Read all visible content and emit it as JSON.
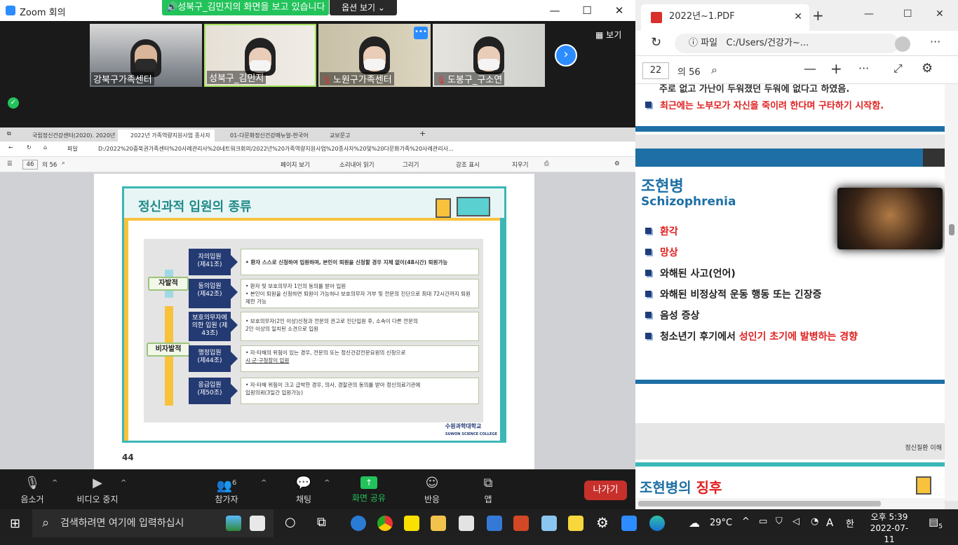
{
  "zoom": {
    "title": "Zoom 회의",
    "share_banner": "성북구_김민지의 화면을 보고 있습니다",
    "share_options": "옵션 보기 ⌄",
    "view_label": "보기",
    "participants": [
      {
        "name": "강북구가족센터",
        "muted": false
      },
      {
        "name": "성북구_김민지",
        "muted": false
      },
      {
        "name": "노원구가족센터",
        "muted": true
      },
      {
        "name": "도봉구_구소연",
        "muted": true
      }
    ],
    "toolbar": {
      "mute": "음소거",
      "video": "비디오 중지",
      "participants": "참가자",
      "participants_count": "6",
      "chat": "채팅",
      "share": "화면 공유",
      "reaction": "반응",
      "apps": "앱",
      "leave": "나가기"
    }
  },
  "shared": {
    "tabs": [
      "국립정신건강센터(2020). 2020년",
      "2022년 가족역량지원사업 종사자",
      "01-다문화정신건강매뉴얼-한국어",
      "교보문고"
    ],
    "address_label": "파일",
    "address": "D:/2022%20중북권가족센터%20사례관리사%20네트워크회의/2022년%20가족역량지원사업%20종사자%20및%20다문화가족%20사례관리사...",
    "page": "46",
    "page_total": "의 56",
    "tools": [
      "페이지 보기",
      "소리내어 읽기",
      "그리기",
      "강조 표시",
      "지우기"
    ],
    "slide": {
      "title": "정신과적 입원의 종류",
      "voluntary": "자발적",
      "involuntary": "비자발적",
      "rows": [
        {
          "tag1": "자의입원",
          "tag2": "(제41조)",
          "desc1": "• 환자 스스로 신청하여 입원하며, 본인이 퇴원을 신청할 경우 지체 없이(48시간) 퇴원가능",
          "desc2": ""
        },
        {
          "tag1": "동의입원",
          "tag2": "(제42조)",
          "desc1": "• 환자 및 보호의무자 1인의 동의를 받아 입원",
          "desc2": "• 본인이 퇴원을 신청하면 퇴원이 가능하나 보호의무자 거부 및 전문의 진단으로 최대 72시간까지 퇴원제한 가능"
        },
        {
          "tag1": "보호의무자에",
          "tag2": "의한 입원 (제43조)",
          "desc1": "• 보호의무자(2인 이상)신청과 전문의 권고로 진단입원 후, 소속이 다른 전문의",
          "desc2": "2인 이상의 일치된 소견으로 입원"
        },
        {
          "tag1": "행정입원",
          "tag2": "(제44조)",
          "desc1": "• 자·타해의 위험이 있는 경우, 전문의 또는 정신건강전문요원의 신청으로",
          "desc2": "시·군·구청장이 입원"
        },
        {
          "tag1": "응급입원",
          "tag2": "(제50조)",
          "desc1": "• 자·타해 위험이 크고 급박한 경우, 의사, 경찰관의 동의를 받아 정신의료기관에",
          "desc2": "입원의뢰(3일간 입원가능)"
        }
      ],
      "footer": "수원과학대학교",
      "footer_sub": "SUWON SCIENCE COLLEGE"
    },
    "page_number": "44"
  },
  "pdf": {
    "tab_title": "2022년~1.PDF",
    "address_label": "파일",
    "address": "C:/Users/건강가~...",
    "page": "22",
    "page_total": "의 56",
    "page1_partial": "주로 없고 가난이 두워졌던 두워에 없다고 하였음.",
    "page1_bullet": "최근에는 노부모가 자신을 죽이려 한다며 구타하기 시작함.",
    "page2_title_ko": "조현병",
    "page2_title_en": "Schizophrenia",
    "page2_bullets": [
      "환각",
      "망상",
      "와해된 사고(언어)",
      "와해된 비정상적 운동 행동 또는 긴장증",
      "음성 증상"
    ],
    "page2_last_prefix": "청소년기 후기에서 ",
    "page2_last_red": "성인기 초기에 발병하는 경향",
    "page2_footer": "정신질환 이해",
    "page3_title_a": "조현병의 ",
    "page3_title_b": "징후"
  },
  "taskbar": {
    "search_placeholder": "검색하려면 여기에 입력하십시",
    "weather": "29°C",
    "ime": "A",
    "ime2": "한",
    "time": "오후 5:39",
    "date": "2022-07-11",
    "notifications": "5"
  }
}
